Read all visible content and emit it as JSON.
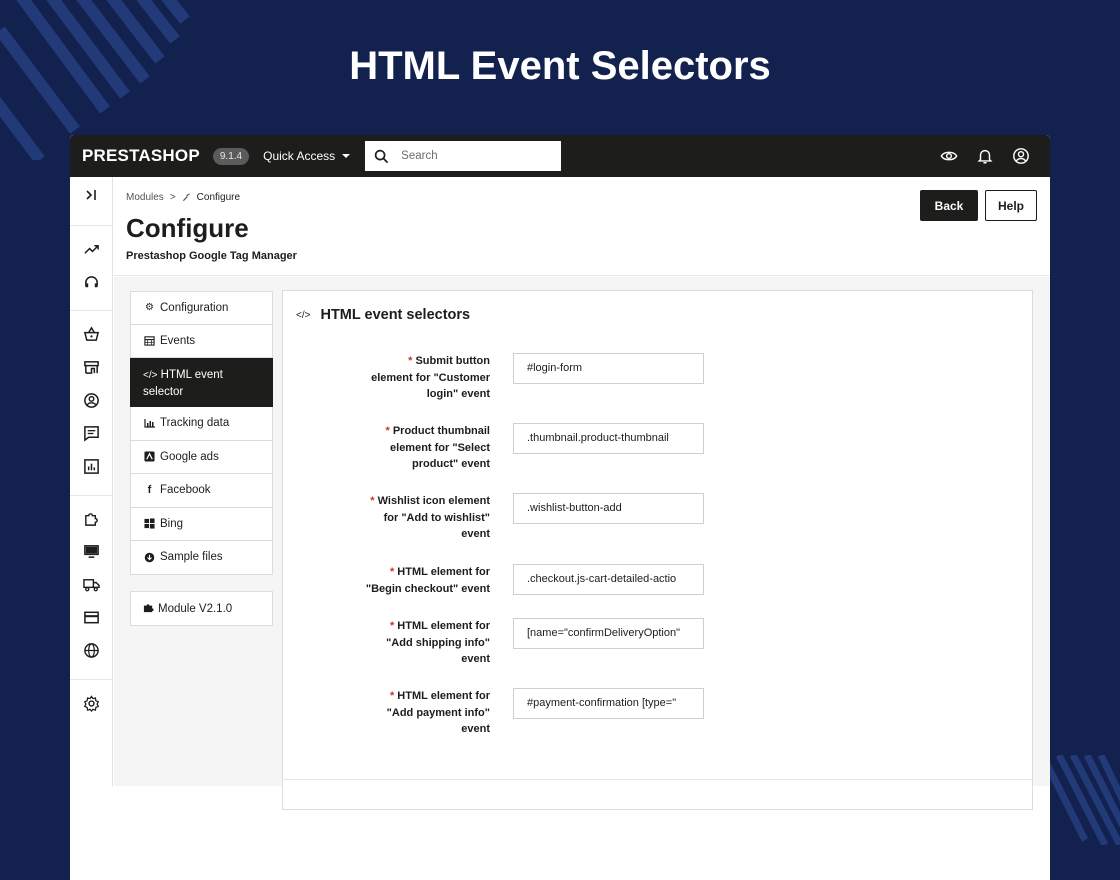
{
  "hero": {
    "title": "HTML Event Selectors"
  },
  "topbar": {
    "logo": "PRESTASHOP",
    "version": "9.1.4",
    "quick_access": "Quick Access",
    "search_placeholder": "Search",
    "icons": [
      "eye-icon",
      "bell-icon",
      "user-icon"
    ]
  },
  "rail": {
    "icons": [
      "collapse-icon",
      "trending-icon",
      "support-icon",
      "basket-icon",
      "store-icon",
      "customer-icon",
      "message-icon",
      "stats-icon",
      "puzzle-icon",
      "monitor-icon",
      "truck-icon",
      "card-icon",
      "globe-icon",
      "gear-icon"
    ]
  },
  "header": {
    "breadcrumb": {
      "parent": "Modules",
      "separator": ">",
      "current": "Configure"
    },
    "title": "Configure",
    "subtitle": "Prestashop Google Tag Manager",
    "back": "Back",
    "help": "Help"
  },
  "tabs": [
    {
      "label": "Configuration",
      "icon": "cogs-icon"
    },
    {
      "label": "Events",
      "icon": "calendar-icon"
    },
    {
      "label": "HTML event selector",
      "icon": "code-icon",
      "active": true
    },
    {
      "label": "Tracking data",
      "icon": "chart-icon"
    },
    {
      "label": "Google ads",
      "icon": "google-ads-icon"
    },
    {
      "label": "Facebook",
      "icon": "facebook-icon"
    },
    {
      "label": "Bing",
      "icon": "windows-icon"
    },
    {
      "label": "Sample files",
      "icon": "download-icon"
    }
  ],
  "module_box": {
    "label": "Module V2.1.0",
    "icon": "puzzle-piece-icon"
  },
  "panel": {
    "title": "HTML event selectors",
    "fields": [
      {
        "required": "*",
        "label_lines": [
          "Submit button",
          "element for \"Customer",
          "login\" event"
        ],
        "value": "#login-form"
      },
      {
        "required": "*",
        "label_lines": [
          "Product thumbnail",
          "element for \"Select",
          "product\" event"
        ],
        "value": ".thumbnail.product-thumbnail"
      },
      {
        "required": "*",
        "label_lines": [
          "Wishlist icon element",
          "for \"Add to wishlist\"",
          "event"
        ],
        "value": ".wishlist-button-add"
      },
      {
        "required": "*",
        "label_lines": [
          "HTML element for",
          "\"Begin checkout\" event"
        ],
        "value": ".checkout.js-cart-detailed-actio"
      },
      {
        "required": "*",
        "label_lines": [
          "HTML element for",
          "\"Add shipping info\"",
          "event"
        ],
        "value": "[name=\"confirmDeliveryOption\""
      },
      {
        "required": "*",
        "label_lines": [
          "HTML element for",
          "\"Add payment info\"",
          "event"
        ],
        "value": "#payment-confirmation [type=\""
      }
    ]
  }
}
